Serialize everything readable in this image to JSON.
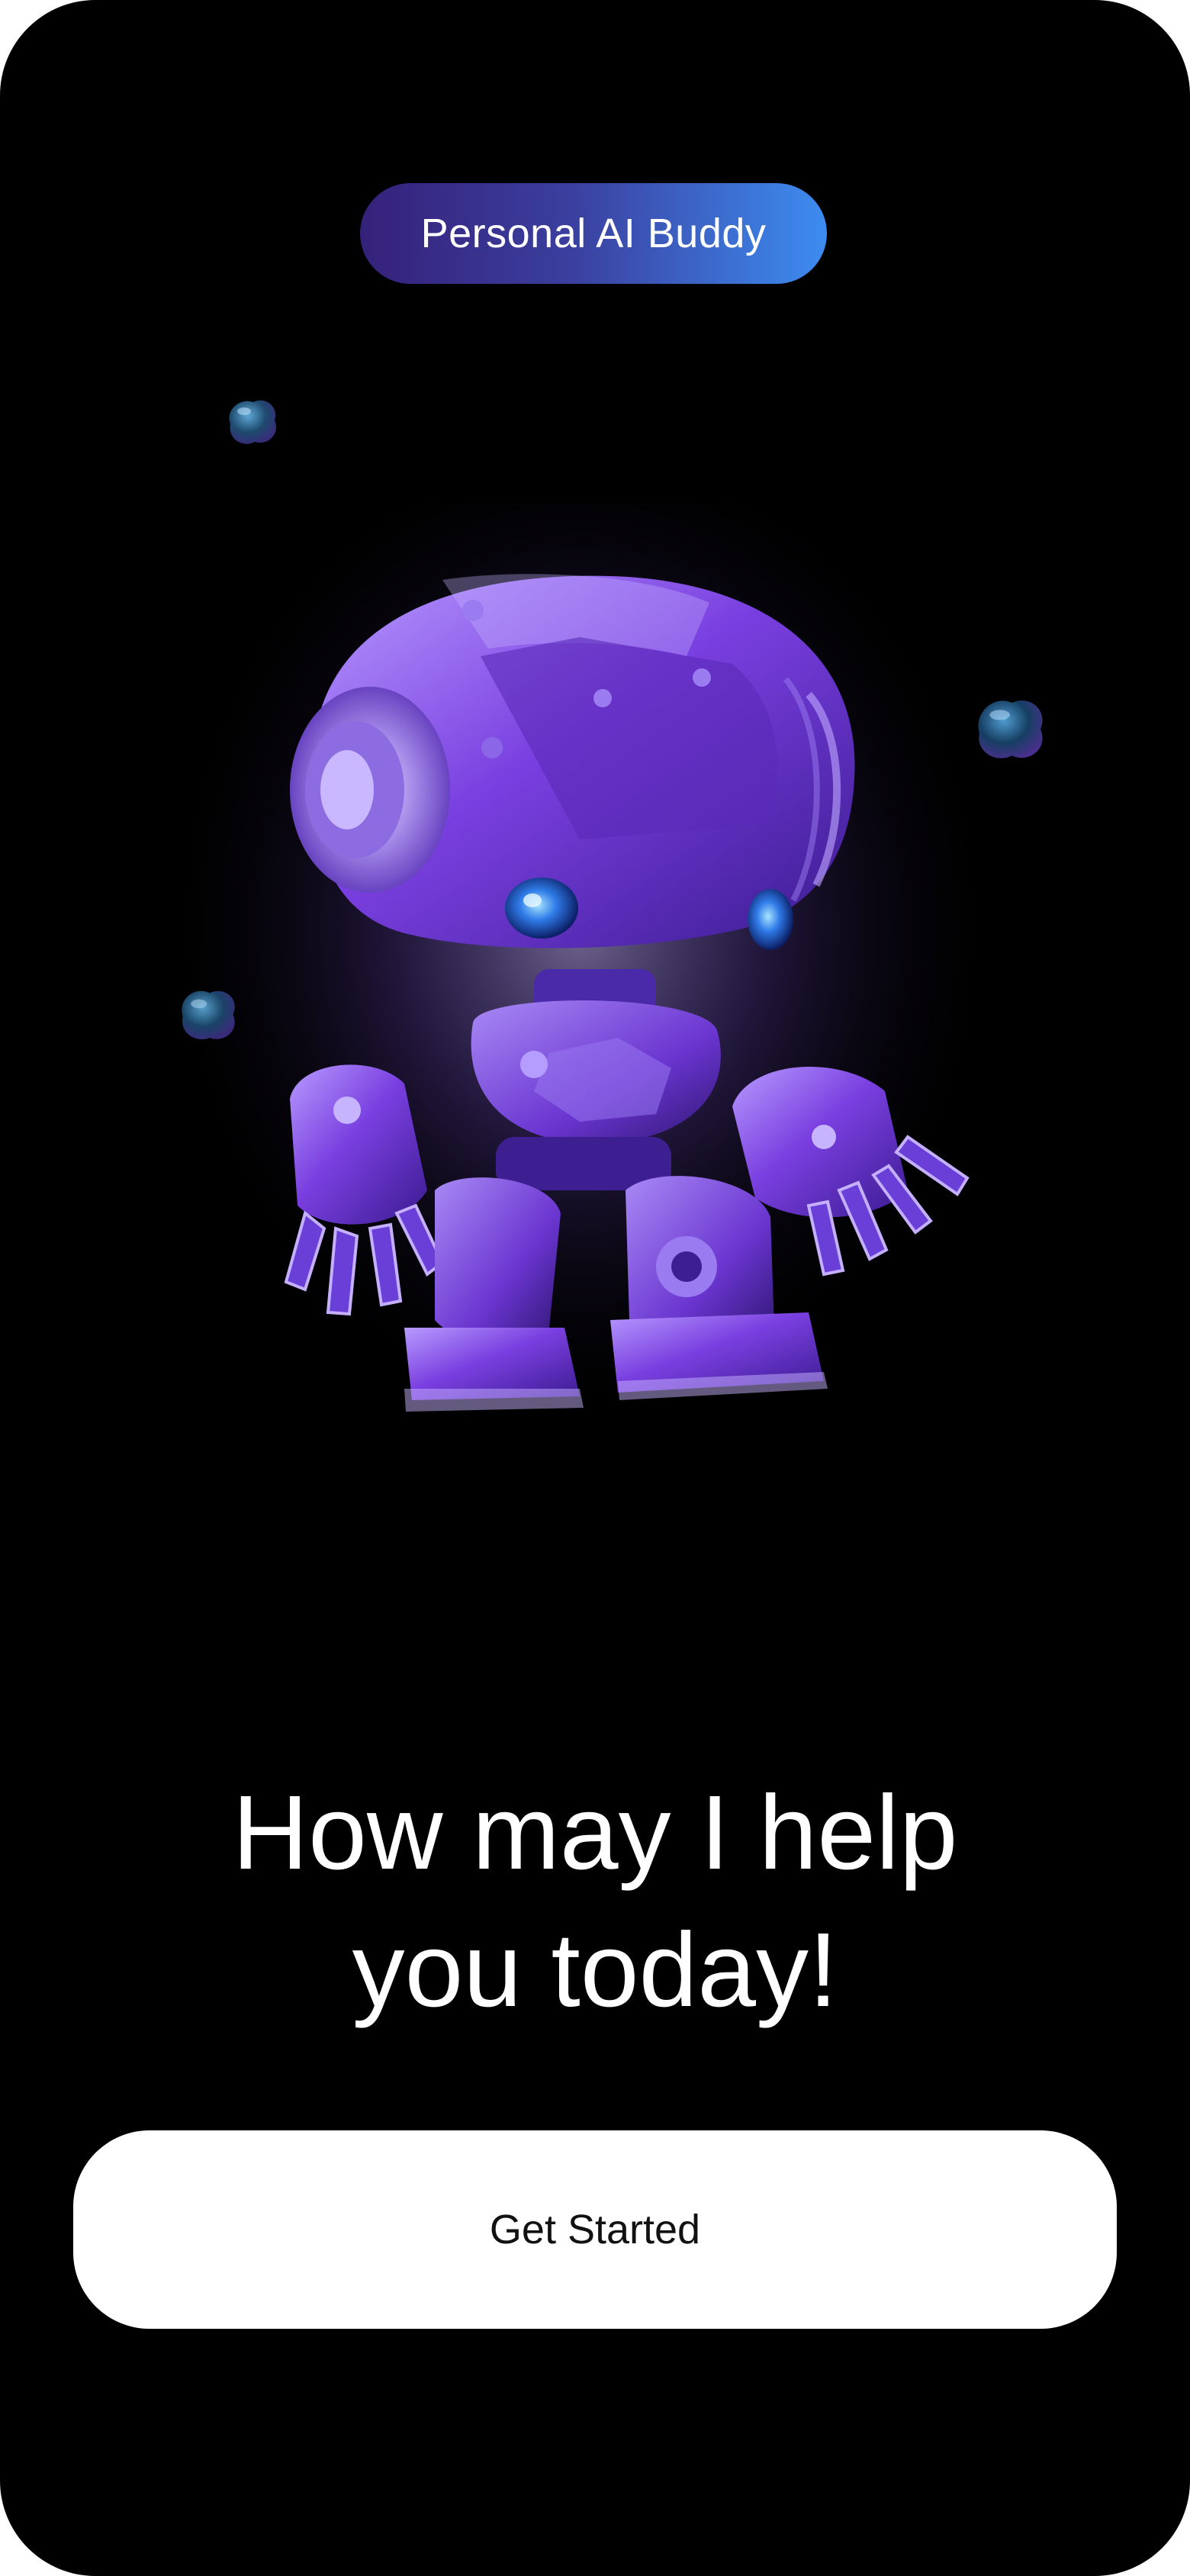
{
  "badge": {
    "label": "Personal AI Buddy"
  },
  "hero": {
    "illustration": "purple-robot",
    "decorations": [
      "bubble-icon",
      "bubble-icon",
      "bubble-icon"
    ]
  },
  "headline": {
    "line1": "How may I help",
    "line2": "you today!"
  },
  "cta": {
    "label": "Get Started"
  },
  "colors": {
    "background": "#000000",
    "badge_gradient_start": "#35217a",
    "badge_gradient_end": "#3d8cf0",
    "robot_primary": "#7b3fe4",
    "robot_glow": "#b9a6ff",
    "button_background": "#ffffff"
  }
}
